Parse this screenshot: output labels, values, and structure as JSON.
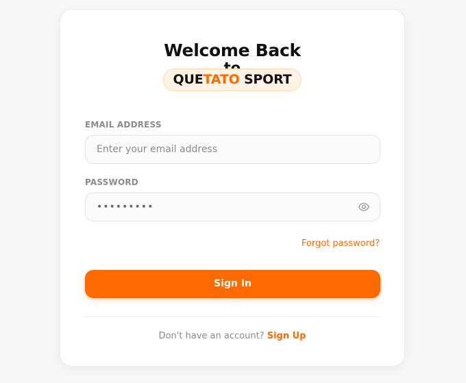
{
  "header": {
    "title": "Welcome Back",
    "subtitle": "to",
    "brand_part1": "QUE",
    "brand_part2": "TATO",
    "brand_part3": "SPORT"
  },
  "form": {
    "email_label": "EMAIL ADDRESS",
    "email_placeholder": "Enter your email address",
    "password_label": "PASSWORD",
    "password_value": "•••••••••",
    "show_password_icon": "eye-icon",
    "forgot_password": "Forgot password?",
    "submit_label": "Sign In"
  },
  "footer": {
    "prompt": "Don't have an account?",
    "signup_label": "Sign Up"
  },
  "colors": {
    "accent": "#ff6a00",
    "badge_bg": "#fff3e6",
    "text_dark": "#111111",
    "text_muted": "#8a8a8a"
  }
}
